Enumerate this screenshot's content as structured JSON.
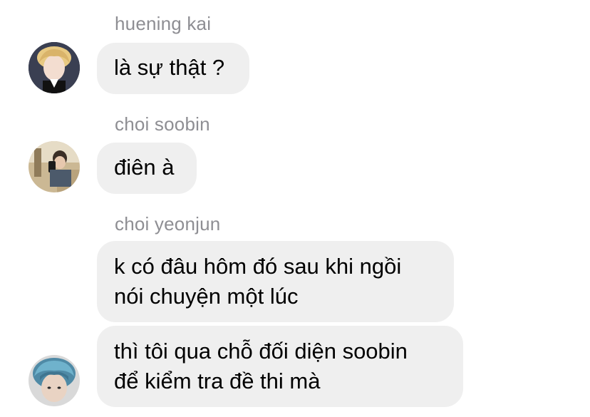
{
  "messages": [
    {
      "sender": "huening kai",
      "avatar_icon": "user-avatar-blond-hair",
      "bubbles": [
        {
          "lines": [
            "là sự thật ?"
          ]
        }
      ]
    },
    {
      "sender": "choi soobin",
      "avatar_icon": "user-avatar-mirror-selfie",
      "bubbles": [
        {
          "lines": [
            "điên à"
          ]
        }
      ]
    },
    {
      "sender": "choi yeonjun",
      "avatar_icon": "user-avatar-blue-hair",
      "bubbles": [
        {
          "lines": [
            "k có đâu hôm đó sau khi ngồi",
            "nói chuyện một lúc"
          ]
        },
        {
          "lines": [
            "thì tôi qua chỗ đối diện soobin",
            "để kiểm tra đề thi mà"
          ]
        }
      ]
    }
  ],
  "colors": {
    "bubble_background": "#efefef",
    "sender_name": "#8e8e93",
    "message_text": "#000000",
    "background": "#ffffff"
  }
}
